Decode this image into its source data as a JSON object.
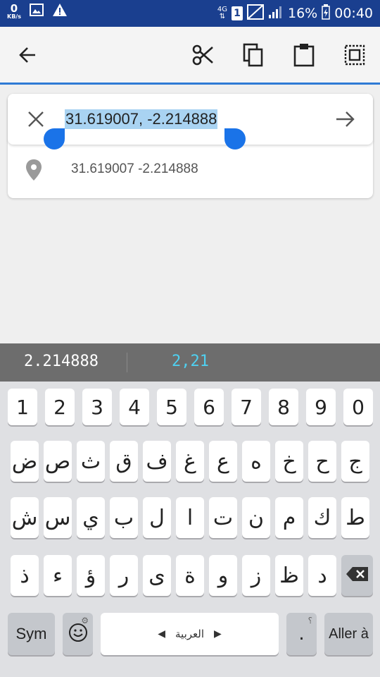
{
  "status_bar": {
    "speed_value": "0",
    "speed_unit": "KB/s",
    "network_type": "4G",
    "sim_slot": "1",
    "battery_percent": "16%",
    "time": "00:40"
  },
  "toolbar": {
    "back_icon": "arrow-left",
    "cut_icon": "scissors",
    "copy_icon": "copy",
    "paste_icon": "clipboard",
    "select_all_icon": "select-all"
  },
  "search": {
    "query": "31.619007, -2.214888",
    "selection_color": "#a9d3f2",
    "handle_color": "#1a73e8"
  },
  "result": {
    "text": "31.619007 -2.214888"
  },
  "suggestions": {
    "primary": "2.214888",
    "secondary": "2,21"
  },
  "keyboard": {
    "numbers": [
      "1",
      "2",
      "3",
      "4",
      "5",
      "6",
      "7",
      "8",
      "9",
      "0"
    ],
    "row1": [
      "ض",
      "ص",
      "ث",
      "ق",
      "ف",
      "غ",
      "ع",
      "ه",
      "خ",
      "ح",
      "ج"
    ],
    "row2": [
      "ش",
      "س",
      "ي",
      "ب",
      "ل",
      "ا",
      "ت",
      "ن",
      "م",
      "ك",
      "ط"
    ],
    "row3": [
      "ذ",
      "ء",
      "ؤ",
      "ر",
      "ى",
      "ة",
      "و",
      "ز",
      "ظ",
      "د"
    ],
    "sym_label": "Sym",
    "emoji_icon": "smiley",
    "space_label": "العربية",
    "punct_hint": "؟",
    "punct_main": ".",
    "enter_label": "Aller à",
    "backspace_icon": "backspace"
  }
}
